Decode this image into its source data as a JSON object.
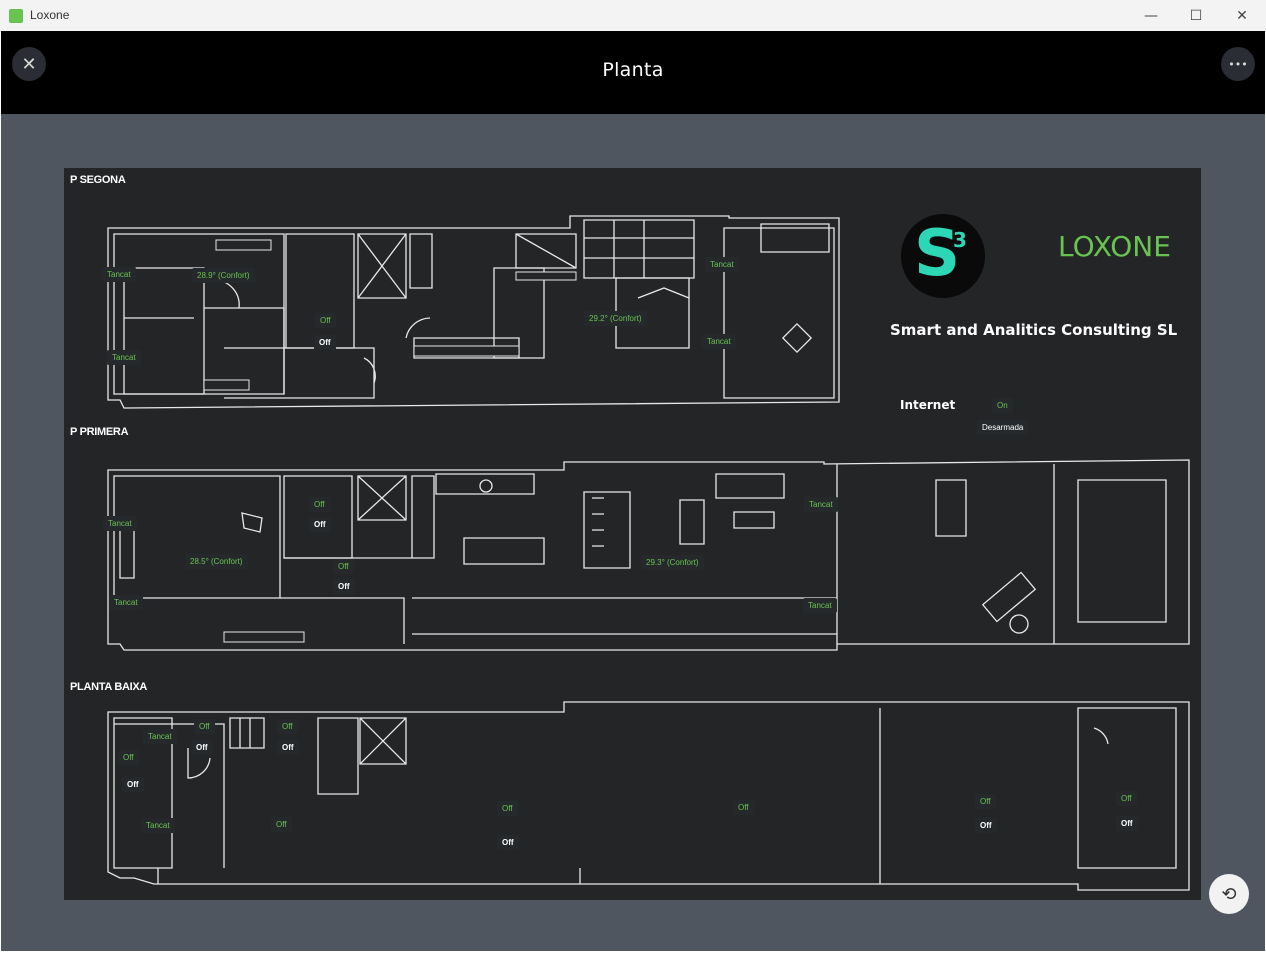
{
  "window": {
    "app_title": "Loxone",
    "minimize": "—",
    "maximize": "☐",
    "close": "✕"
  },
  "header": {
    "title": "Planta",
    "close_icon": "✕",
    "more_icon": "•••"
  },
  "floors": [
    {
      "name": "P SEGONA"
    },
    {
      "name": "P PRIMERA"
    },
    {
      "name": "PLANTA BAIXA"
    }
  ],
  "brand": {
    "s3_letter": "S",
    "s3_sup": "3",
    "loxone": "LOXONE",
    "company": "Smart and Analitics Consulting SL"
  },
  "internet": {
    "label": "Internet",
    "status": "On",
    "alarm": "Desarmada"
  },
  "controls": {
    "p2_tancat_1": "Tancat",
    "p2_temp_1": "28.9° (Confort)",
    "p2_tancat_2": "Tancat",
    "p2_off_1": "Off",
    "p2_off_2": "Off",
    "p2_temp_2": "29.2° (Confort)",
    "p2_tancat_3": "Tancat",
    "p2_tancat_4": "Tancat",
    "p1_tancat_1": "Tancat",
    "p1_temp_1": "28.5° (Confort)",
    "p1_tancat_2": "Tancat",
    "p1_off_1": "Off",
    "p1_off_2": "Off",
    "p1_off_3": "Off",
    "p1_off_4": "Off",
    "p1_temp_2": "29.3° (Confort)",
    "p1_tancat_3": "Tancat",
    "p1_tancat_4": "Tancat",
    "pb_off_1": "Off",
    "pb_off_2": "Off",
    "pb_tancat_1": "Tancat",
    "pb_off_3": "Off",
    "pb_off_4": "Off",
    "pb_off_5": "Off",
    "pb_off_6": "Off",
    "pb_tancat_2": "Tancat",
    "pb_off_7": "Off",
    "pb_off_8": "Off",
    "pb_off_9": "Off",
    "pb_off_10": "Off",
    "pb_off_11": "Off",
    "pb_off_12": "Off",
    "pb_off_13": "Off",
    "pb_off_14": "Off"
  },
  "refresh_icon": "⟲"
}
